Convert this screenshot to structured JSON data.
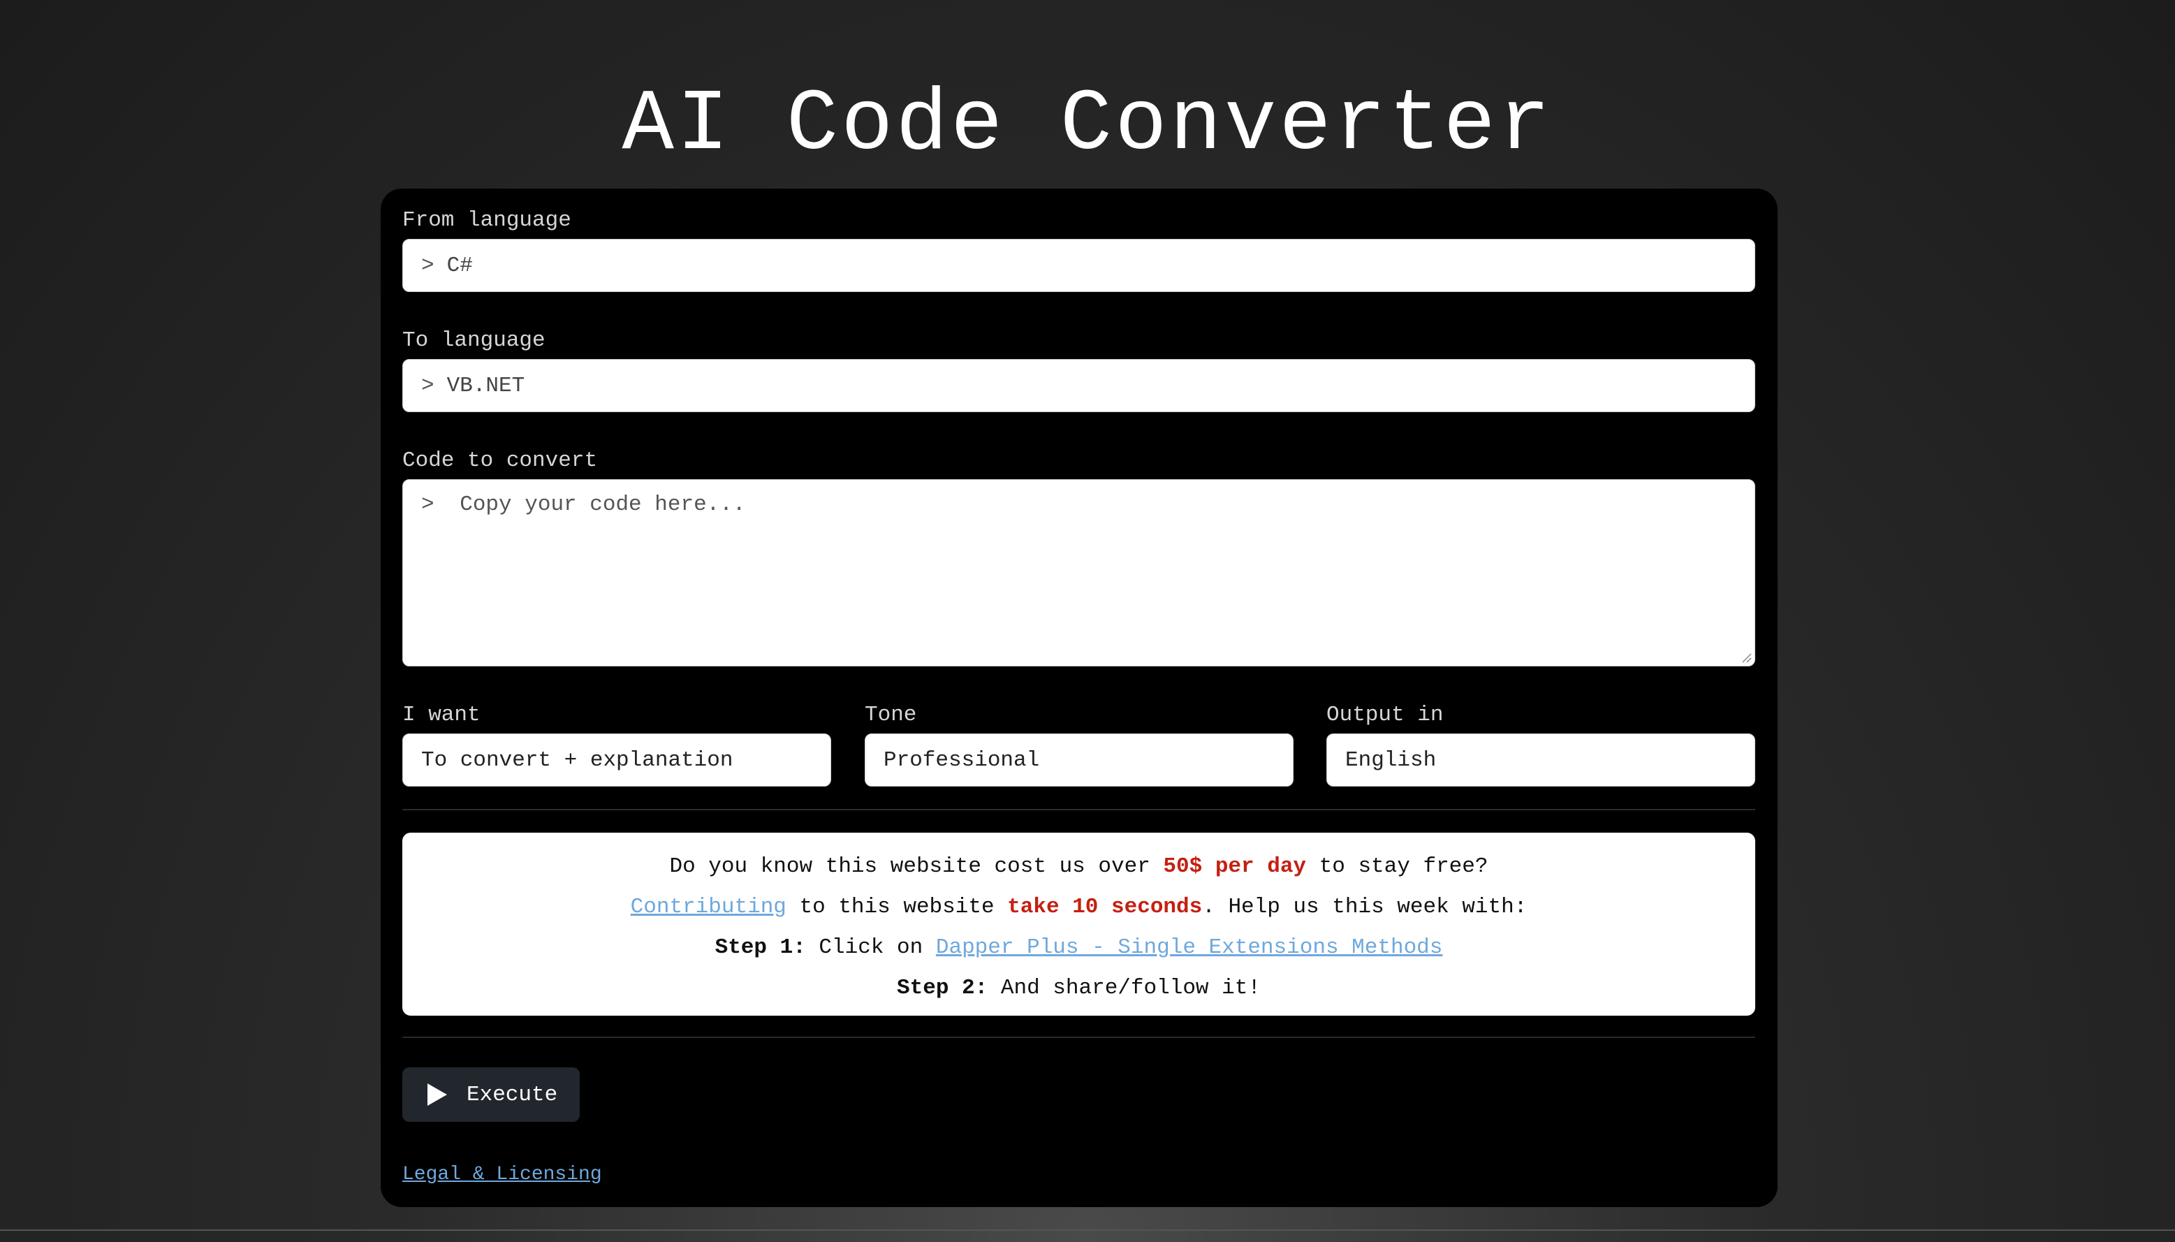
{
  "page": {
    "title": "AI Code Converter"
  },
  "form": {
    "from_language": {
      "label": "From language",
      "prompt": ">",
      "value": "C#"
    },
    "to_language": {
      "label": "To language",
      "prompt": ">",
      "value": "VB.NET"
    },
    "code": {
      "label": "Code to convert",
      "prompt": ">",
      "placeholder": "Copy your code here..."
    },
    "i_want": {
      "label": "I want",
      "value": "To convert + explanation"
    },
    "tone": {
      "label": "Tone",
      "value": "Professional"
    },
    "output_in": {
      "label": "Output in",
      "value": "English"
    }
  },
  "notice": {
    "line1_pre": "Do you know this website cost us over ",
    "line1_highlight": "50$ per day",
    "line1_post": " to stay free?",
    "line2_link": "Contributing",
    "line2_mid": " to this website ",
    "line2_highlight": "take 10 seconds",
    "line2_post": ". Help us this week with:",
    "step1_label": "Step 1:",
    "step1_text": " Click on ",
    "step1_link": "Dapper Plus - Single Extensions Methods",
    "step2_label": "Step 2:",
    "step2_text": " And share/follow it!"
  },
  "actions": {
    "execute_label": "Execute"
  },
  "footer": {
    "legal_link": "Legal & Licensing"
  },
  "colors": {
    "highlight": "#c42012",
    "link": "#6fa8dc",
    "panel": "#000000"
  }
}
